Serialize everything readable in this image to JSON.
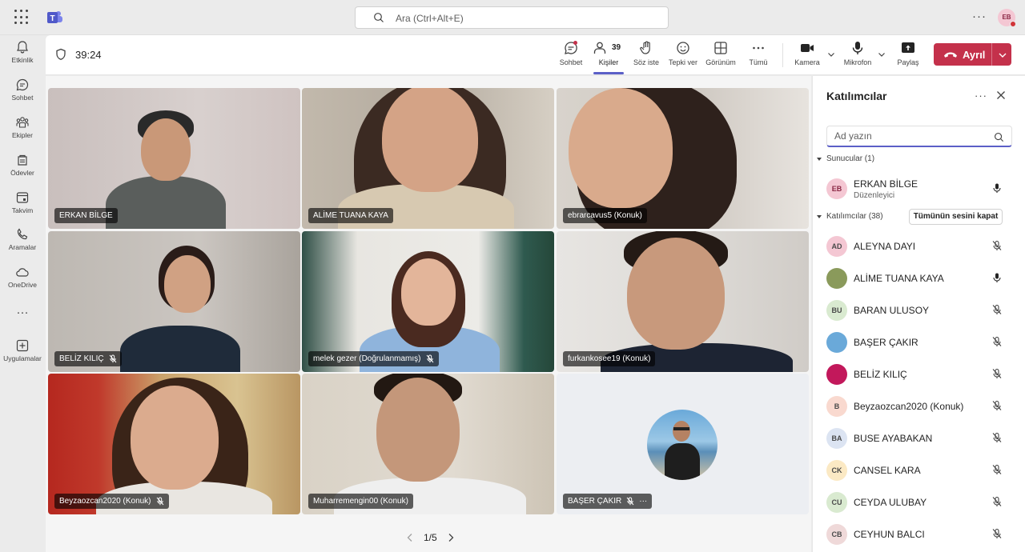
{
  "titlebar": {
    "search_placeholder": "Ara (Ctrl+Alt+E)",
    "more": "···",
    "user_initials": "EB"
  },
  "rail": {
    "items": [
      {
        "label": "Etkinlik",
        "icon": "bell-icon"
      },
      {
        "label": "Sohbet",
        "icon": "chat-icon"
      },
      {
        "label": "Ekipler",
        "icon": "teams-icon"
      },
      {
        "label": "Ödevler",
        "icon": "assignments-icon"
      },
      {
        "label": "Takvim",
        "icon": "calendar-icon"
      },
      {
        "label": "Aramalar",
        "icon": "phone-icon"
      },
      {
        "label": "OneDrive",
        "icon": "cloud-icon"
      },
      {
        "label": "Uygulamalar",
        "icon": "add-apps-icon"
      }
    ],
    "more": "···"
  },
  "meeting": {
    "timer": "39:24",
    "participant_count": "39",
    "tools": {
      "chat": "Sohbet",
      "people": "Kişiler",
      "raise_hand": "Söz iste",
      "react": "Tepki ver",
      "view": "Görünüm",
      "more": "Tümü",
      "camera": "Kamera",
      "mic": "Mikrofon",
      "share": "Paylaş"
    },
    "leave_label": "Ayrıl"
  },
  "stage": {
    "tiles": [
      {
        "name": "ERKAN BİLGE",
        "muted": false
      },
      {
        "name": "ALİME TUANA KAYA",
        "muted": false
      },
      {
        "name": "ebrarcavus5 (Konuk)",
        "muted": false
      },
      {
        "name": "BELİZ KILIÇ",
        "muted": true
      },
      {
        "name": "melek gezer (Doğrulanmamış)",
        "muted": true
      },
      {
        "name": "furkankosee19 (Konuk)",
        "muted": false
      },
      {
        "name": "Beyzaozcan2020 (Konuk)",
        "muted": true
      },
      {
        "name": "Muharremengin00 (Konuk)",
        "muted": false
      },
      {
        "name": "BAŞER ÇAKIR",
        "muted": true,
        "more": "···"
      }
    ],
    "pager": "1/5"
  },
  "panel": {
    "title": "Katılımcılar",
    "more": "···",
    "search_placeholder": "Ad yazın",
    "presenters_header": "Sunucular (1)",
    "presenter": {
      "initials": "EB",
      "name": "ERKAN BİLGE",
      "role": "Düzenleyici"
    },
    "attendees_header": "Katılımcılar (38)",
    "mute_all": "Tümünün sesini kapat",
    "attendees": [
      {
        "initials": "AD",
        "name": "ALEYNA DAYI",
        "muted": true,
        "color": "#f4c7d3"
      },
      {
        "initials": "",
        "name": "ALİME TUANA KAYA",
        "muted": false,
        "color": "#8a9a5b"
      },
      {
        "initials": "BU",
        "name": "BARAN ULUSOY",
        "muted": true,
        "color": "#d9ead0"
      },
      {
        "initials": "",
        "name": "BAŞER ÇAKIR",
        "muted": true,
        "color": "#6aa9d9"
      },
      {
        "initials": "",
        "name": "BELİZ KILIÇ",
        "muted": true,
        "color": "#c2185b"
      },
      {
        "initials": "B",
        "name": "Beyzaozcan2020 (Konuk)",
        "muted": true,
        "color": "#f9d9cf"
      },
      {
        "initials": "BA",
        "name": "BUSE AYABAKAN",
        "muted": true,
        "color": "#dce4f2"
      },
      {
        "initials": "CK",
        "name": "CANSEL KARA",
        "muted": true,
        "color": "#fbe9c4"
      },
      {
        "initials": "CU",
        "name": "CEYDA ULUBAY",
        "muted": true,
        "color": "#d9ead0"
      },
      {
        "initials": "CB",
        "name": "CEYHUN BALCI",
        "muted": true,
        "color": "#efd9d9"
      }
    ]
  }
}
